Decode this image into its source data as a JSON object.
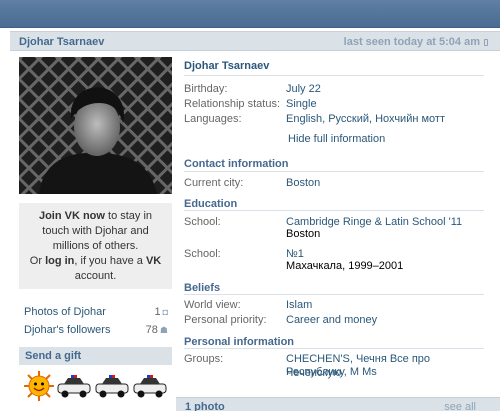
{
  "header": {
    "name": "Djohar Tsarnaev",
    "last_seen": "last seen today at 5:04 am"
  },
  "sidebar": {
    "join_bold": "Join VK now",
    "join_text": " to stay in touch with Djohar and millions of others.",
    "or_text": "Or ",
    "login_bold": "log in",
    "login_text": ", if you have a ",
    "vk_bold": "VK",
    "account_text": " account.",
    "photos_label": "Photos of Djohar",
    "photos_count": "1",
    "followers_label": "Djohar's followers",
    "followers_count": "78",
    "gift_title": "Send a gift"
  },
  "profile": {
    "name": "Djohar Tsarnaev",
    "birthday_label": "Birthday:",
    "birthday": "July 22",
    "relationship_label": "Relationship status:",
    "relationship": "Single",
    "languages_label": "Languages:",
    "languages": "English, Русский, Нохчийн мотт",
    "hide_link": "Hide full information"
  },
  "contact": {
    "title": "Contact information",
    "city_label": "Current city:",
    "city": "Boston"
  },
  "education": {
    "title": "Education",
    "school1_label": "School:",
    "school1": "Cambridge Ringe & Latin School '11",
    "school1_city": "Boston",
    "school2_label": "School:",
    "school2": "№1",
    "school2_detail": "Махачкала, 1999–2001"
  },
  "beliefs": {
    "title": "Beliefs",
    "world_label": "World view:",
    "world": "Islam",
    "priority_label": "Personal priority:",
    "priority": "Career and money"
  },
  "personal": {
    "title": "Personal information",
    "groups_label": "Groups:",
    "groups_line1": "CHECHEN'S, Чечня Все про Чеченскую",
    "groups_line2": "Республику, M Ms"
  },
  "footer": {
    "photos": "1 photo",
    "see_all": "see all"
  }
}
